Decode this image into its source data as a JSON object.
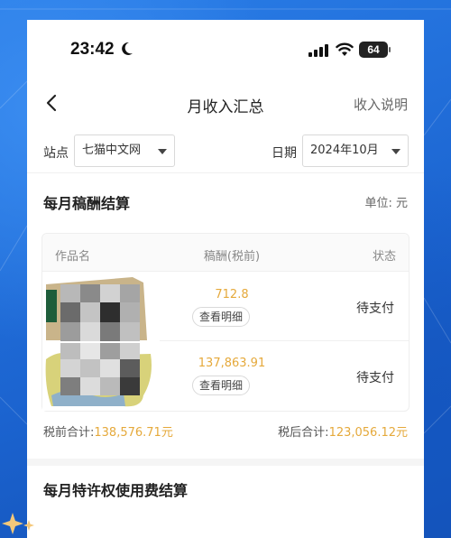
{
  "status_bar": {
    "time": "23:42",
    "battery": "64"
  },
  "nav": {
    "title": "月收入汇总",
    "right_link": "收入说明"
  },
  "filters": {
    "site_label": "站点",
    "site_value": "七猫中文网",
    "date_label": "日期",
    "date_value": "2024年10月"
  },
  "monthly": {
    "title": "每月稿酬结算",
    "unit": "单位: 元",
    "columns": [
      "作品名",
      "稿酬(税前)",
      "状态"
    ],
    "rows": [
      {
        "amount": "712.8",
        "detail": "查看明细",
        "status": "待支付"
      },
      {
        "amount": "137,863.91",
        "detail": "查看明细",
        "status": "待支付"
      }
    ],
    "pre_tax_label": "税前合计:",
    "pre_tax_value": "138,576.71元",
    "post_tax_label": "税后合计:",
    "post_tax_value": "123,056.12元"
  },
  "license_section": {
    "title": "每月特许权使用费结算"
  },
  "colors": {
    "accent": "#e5a93b",
    "background_blue": "#1e6fd9"
  }
}
